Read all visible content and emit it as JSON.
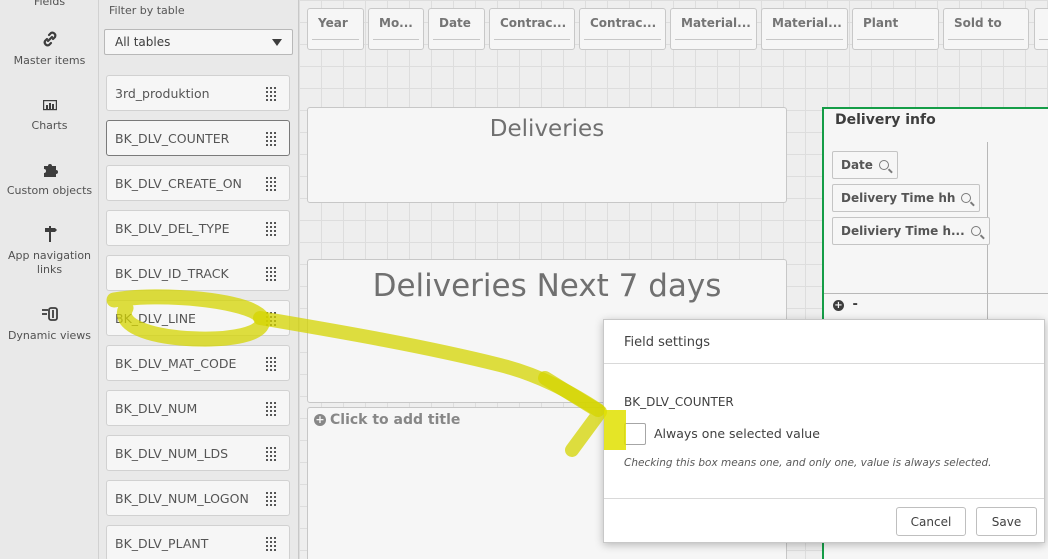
{
  "rail": {
    "top_label": "Fields",
    "items": [
      {
        "label": "Master items",
        "icon": "link-icon"
      },
      {
        "label": "Charts",
        "icon": "chart-icon"
      },
      {
        "label": "Custom objects",
        "icon": "puzzle-icon"
      },
      {
        "label": "App navigation links",
        "icon": "signpost-icon"
      },
      {
        "label": "Dynamic views",
        "icon": "dynamic-view-icon"
      }
    ]
  },
  "field_panel": {
    "filter_label": "Filter by table",
    "filter_value": "All tables",
    "fields": [
      "3rd_produktion",
      "BK_DLV_COUNTER",
      "BK_DLV_CREATE_ON",
      "BK_DLV_DEL_TYPE",
      "BK_DLV_ID_TRACK",
      "BK_DLV_LINE",
      "BK_DLV_MAT_CODE",
      "BK_DLV_NUM",
      "BK_DLV_NUM_LDS",
      "BK_DLV_NUM_LOGON",
      "BK_DLV_PLANT"
    ]
  },
  "canvas": {
    "filter_buttons": [
      "Year",
      "Mo...",
      "Date",
      "Contrac...",
      "Contrac...",
      "Material...",
      "Material...",
      "Plant",
      "Sold to"
    ],
    "deliveries_title": "Deliveries",
    "next7_title": "Deliveries Next 7 days",
    "click_to_add_title": "Click to add title",
    "container": {
      "title": "Delivery info",
      "chips": [
        "Date",
        "Delivery Time hh",
        "Deliviery Time h..."
      ],
      "add_symbol": "-"
    }
  },
  "dialog": {
    "title": "Field settings",
    "field_name": "BK_DLV_COUNTER",
    "checkbox_label": "Always one selected value",
    "checkbox_checked": false,
    "help_text": "Checking this box means one, and only one, value is always selected.",
    "cancel_label": "Cancel",
    "save_label": "Save"
  },
  "colors": {
    "container_border": "#16a34a",
    "annotation": "#d4d400"
  }
}
